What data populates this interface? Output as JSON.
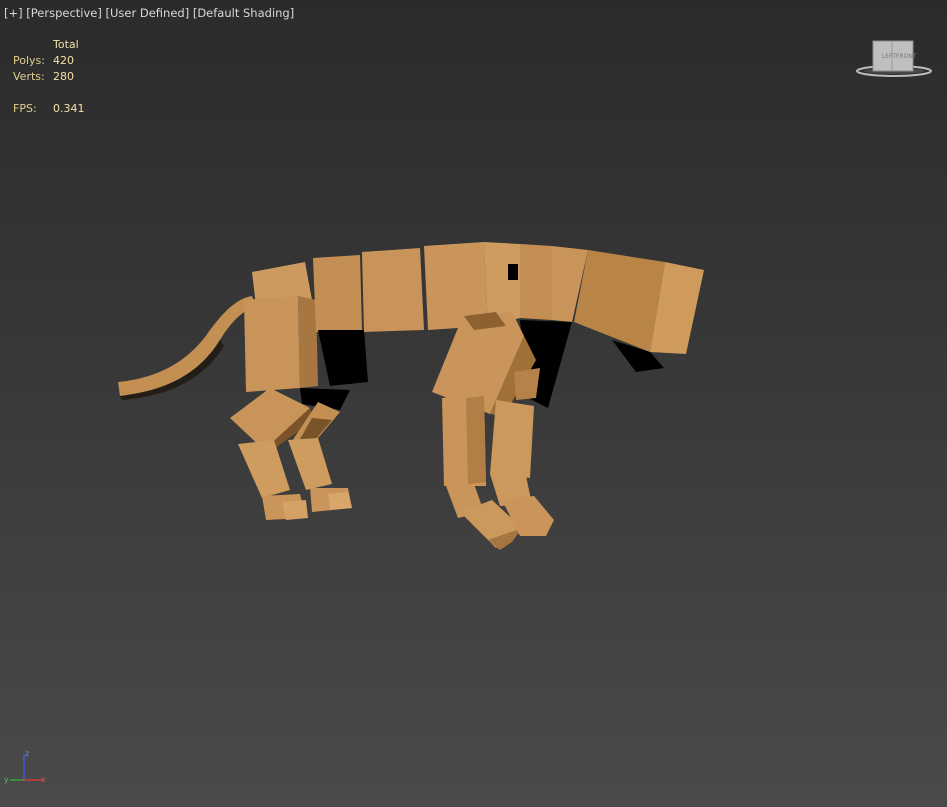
{
  "viewport": {
    "label_parts": [
      "[+]",
      "[Perspective]",
      "[User Defined]",
      "[Default Shading]"
    ]
  },
  "stats": {
    "header": "Total",
    "polys_label": "Polys:",
    "polys_value": "420",
    "verts_label": "Verts:",
    "verts_value": "280",
    "fps_label": "FPS:",
    "fps_value": "0.341"
  },
  "viewcube": {
    "left_face": "LEFT",
    "front_face": "FRONT"
  },
  "axis_tripod": {
    "x": "x",
    "y": "y",
    "z": "z"
  },
  "colors": {
    "model_light": "#c9955a",
    "model_mid": "#b27f45",
    "model_dark": "#7a5428",
    "shadow": "#000000"
  }
}
